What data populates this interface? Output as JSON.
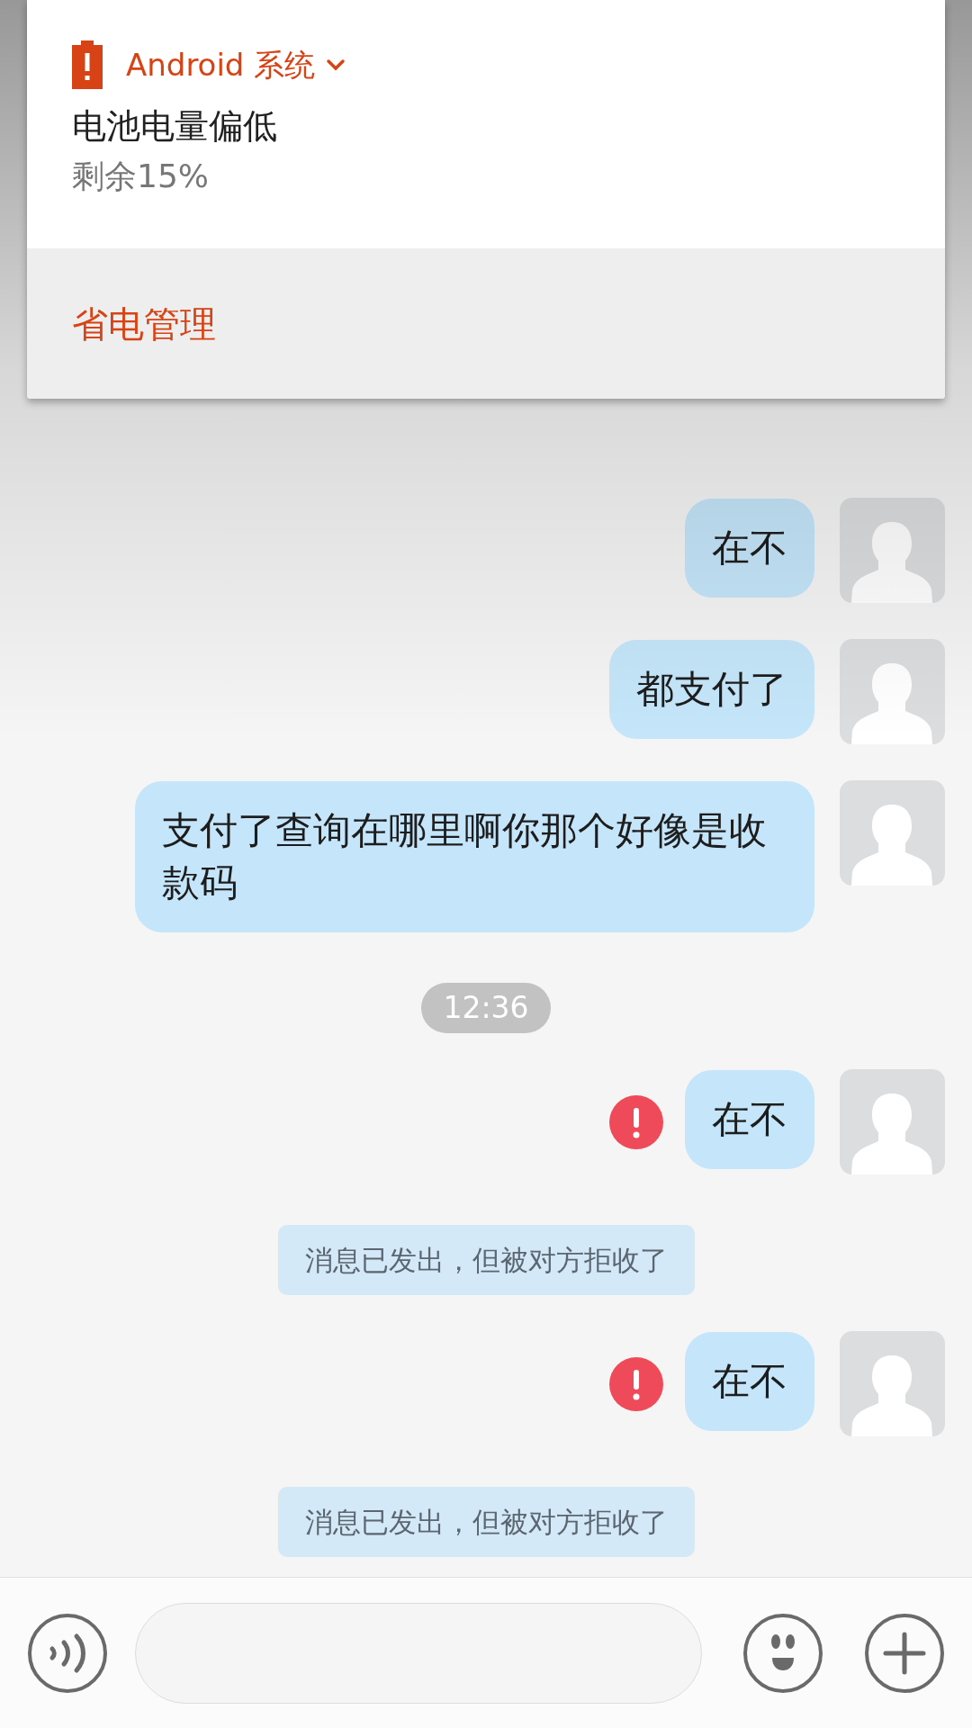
{
  "notification": {
    "app_name": "Android 系统",
    "title": "电池电量偏低",
    "text": "剩余15%",
    "action": "省电管理"
  },
  "messages": [
    {
      "kind": "text",
      "text": "在不",
      "failed": false
    },
    {
      "kind": "text",
      "text": "都支付了",
      "failed": false
    },
    {
      "kind": "text",
      "text": "支付了查询在哪里啊你那个好像是收款码",
      "failed": false
    },
    {
      "kind": "time",
      "text": "12:36"
    },
    {
      "kind": "text",
      "text": "在不",
      "failed": true
    },
    {
      "kind": "notice",
      "text": "消息已发出，但被对方拒收了"
    },
    {
      "kind": "text",
      "text": "在不",
      "failed": true
    },
    {
      "kind": "notice",
      "text": "消息已发出，但被对方拒收了"
    }
  ]
}
